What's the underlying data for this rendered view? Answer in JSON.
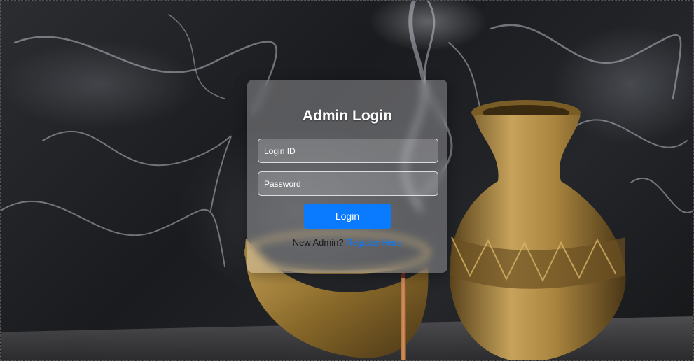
{
  "login_card": {
    "title": "Admin Login",
    "login_id_placeholder": "Login ID",
    "password_placeholder": "Password",
    "login_button_label": "Login",
    "register_prompt": "New Admin?",
    "register_link_label": "Register Here"
  },
  "colors": {
    "accent": "#0a7bff",
    "title_text": "#ffffff"
  }
}
